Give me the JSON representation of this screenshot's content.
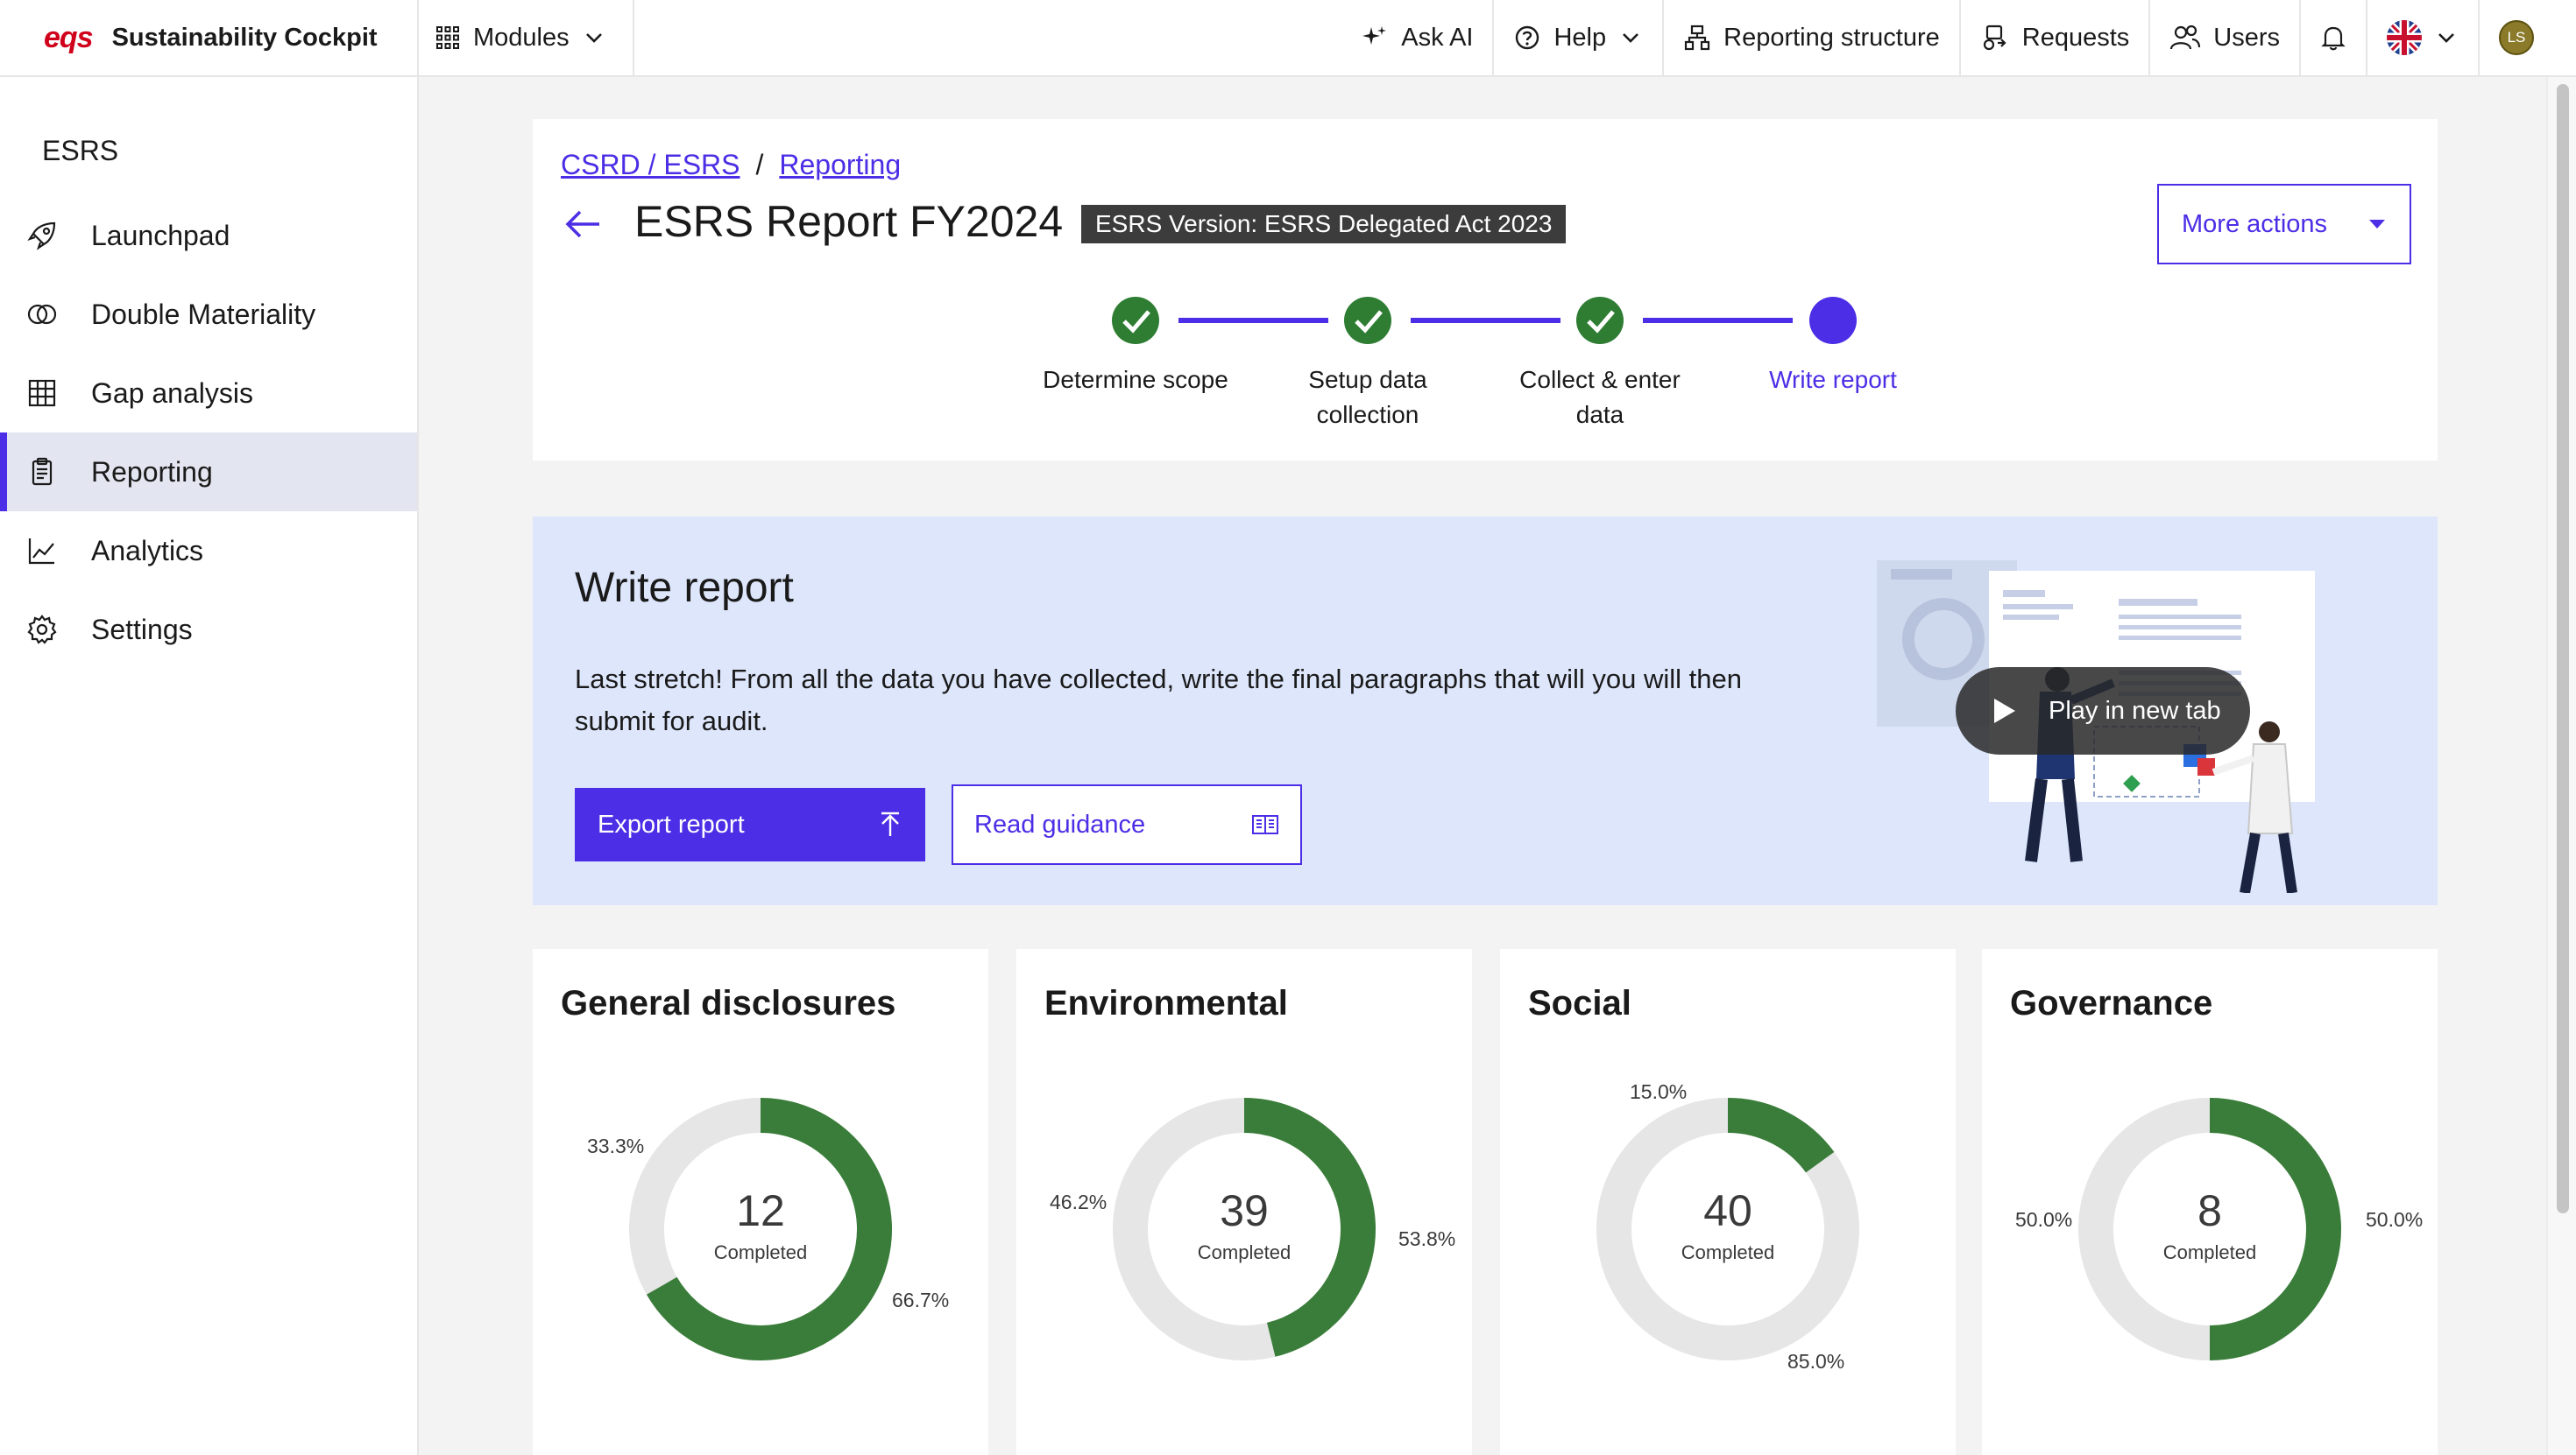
{
  "topbar": {
    "brand_logo": "eqs",
    "brand_name": "Sustainability Cockpit",
    "modules_label": "Modules",
    "ask_ai": "Ask AI",
    "help": "Help",
    "reporting_structure": "Reporting structure",
    "requests": "Requests",
    "users": "Users",
    "avatar_initials": "LS"
  },
  "sidebar": {
    "title": "ESRS",
    "items": [
      {
        "label": "Launchpad",
        "icon": "rocket-icon"
      },
      {
        "label": "Double Materiality",
        "icon": "overlap-circles-icon"
      },
      {
        "label": "Gap analysis",
        "icon": "grid-icon"
      },
      {
        "label": "Reporting",
        "icon": "clipboard-icon",
        "active": true
      },
      {
        "label": "Analytics",
        "icon": "line-chart-icon"
      },
      {
        "label": "Settings",
        "icon": "gear-icon"
      }
    ]
  },
  "header": {
    "breadcrumb_1": "CSRD / ESRS",
    "breadcrumb_sep": "/",
    "breadcrumb_2": "Reporting",
    "title": "ESRS Report FY2024",
    "version": "ESRS Version: ESRS Delegated Act 2023",
    "more_actions": "More actions"
  },
  "stepper": {
    "steps": [
      {
        "line1": "Determine scope",
        "line2": "",
        "status": "done"
      },
      {
        "line1": "Setup data",
        "line2": "collection",
        "status": "done"
      },
      {
        "line1": "Collect & enter",
        "line2": "data",
        "status": "done"
      },
      {
        "line1": "Write report",
        "line2": "",
        "status": "current"
      }
    ]
  },
  "banner": {
    "title": "Write report",
    "text": "Last stretch! From all the data you have collected, write the final paragraphs that will you will then submit for audit.",
    "export_label": "Export report",
    "guidance_label": "Read guidance",
    "video_label": "Play in new tab"
  },
  "colors": {
    "accent": "#4b2ee6",
    "done_green": "#2e7d32",
    "donut_green": "#3a7d3a",
    "donut_gray": "#e6e6e6",
    "brand_red": "#d0021b"
  },
  "cards": [
    {
      "title": "General disclosures",
      "count": "12",
      "sub": "Completed",
      "completed_fraction": 0.667,
      "label_done": "66.7%",
      "label_rest": "33.3%"
    },
    {
      "title": "Environmental",
      "count": "39",
      "sub": "Completed",
      "completed_fraction": 0.462,
      "label_done": "46.2%",
      "label_rest": "53.8%"
    },
    {
      "title": "Social",
      "count": "40",
      "sub": "Completed",
      "completed_fraction": 0.15,
      "label_done": "15.0%",
      "label_rest": "85.0%"
    },
    {
      "title": "Governance",
      "count": "8",
      "sub": "Completed",
      "completed_fraction": 0.5,
      "label_done": "50.0%",
      "label_rest": "50.0%"
    }
  ]
}
